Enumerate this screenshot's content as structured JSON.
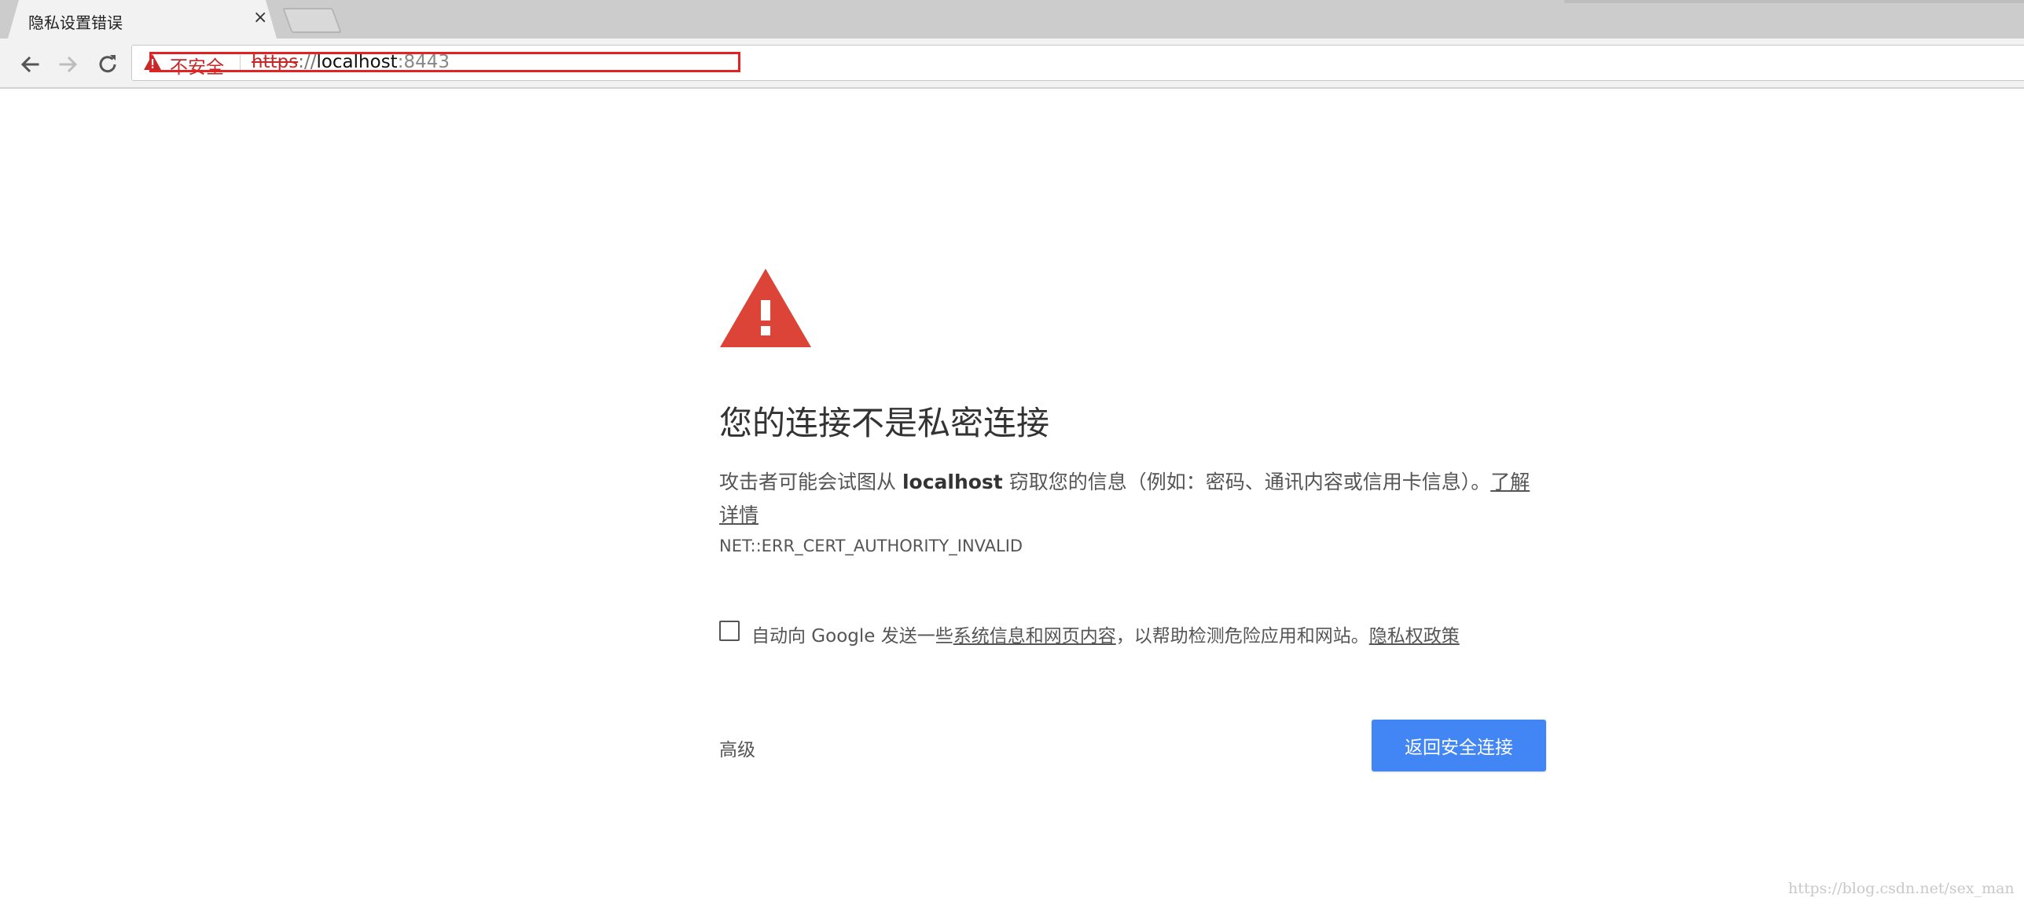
{
  "tab": {
    "title": "隐私设置错误",
    "close_glyph": "×"
  },
  "omnibox": {
    "security_label": "不安全",
    "url_scheme": "https",
    "url_separator": "://",
    "url_host": "localhost",
    "url_port": ":8443"
  },
  "interstitial": {
    "heading": "您的连接不是私密连接",
    "explanation_prefix": "攻击者可能会试图从 ",
    "explanation_host": "localhost",
    "explanation_suffix": " 窃取您的信息（例如：密码、通讯内容或信用卡信息）。",
    "learn_more_link": "了解详情",
    "error_code": "NET::ERR_CERT_AUTHORITY_INVALID",
    "optin_prefix": "自动向 Google 发送一些",
    "optin_link": "系统信息和网页内容",
    "optin_middle": "，以帮助检测危险应用和网站。",
    "privacy_link": "隐私权政策",
    "advanced_label": "高级",
    "primary_button": "返回安全连接",
    "accent_color": "#4285f4",
    "warning_color": "#db4437"
  },
  "watermark": "https://blog.csdn.net/sex_man",
  "icons": [
    "back-arrow-icon",
    "forward-arrow-icon",
    "reload-icon",
    "warning-icon"
  ]
}
